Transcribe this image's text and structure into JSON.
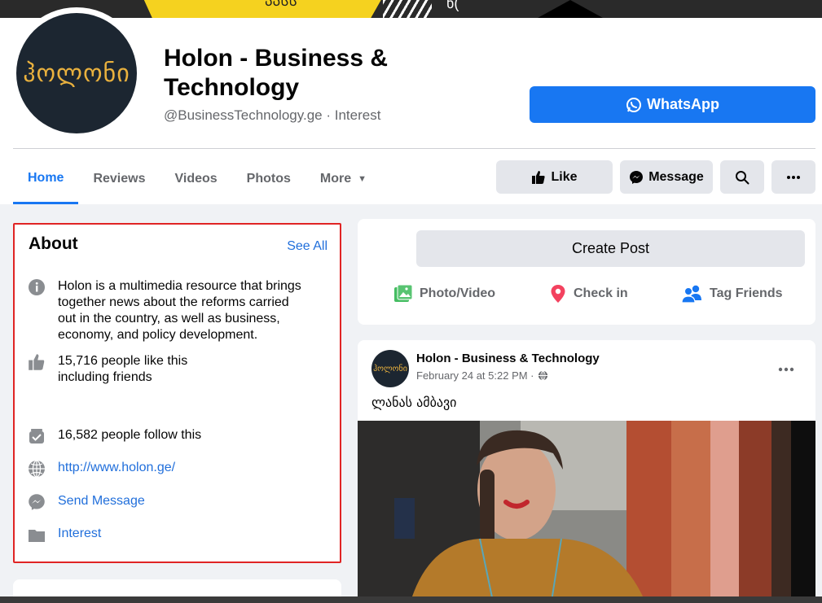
{
  "cover": {
    "sign_text": "ᲐᲐᲡᲡ",
    "sign_fragment": "ნ("
  },
  "page": {
    "logo_text": "ჰოლონი",
    "name": "Holon - Business & Technology",
    "handle": "@BusinessTechnology.ge · Interest",
    "whatsapp_label": "WhatsApp"
  },
  "tabs": [
    {
      "label": "Home",
      "active": true
    },
    {
      "label": "Reviews"
    },
    {
      "label": "Videos"
    },
    {
      "label": "Photos"
    },
    {
      "label": "More"
    }
  ],
  "actions": {
    "like": "Like",
    "message": "Message"
  },
  "about": {
    "title": "About",
    "see_all": "See All",
    "description": "Holon is a multimedia resource that brings together news about the reforms carried out in the country, as well as business, economy, and policy development.",
    "likes": "15,716 people like this including friends",
    "follows": "16,582 people follow this",
    "website": "http://www.holon.ge/",
    "send_message": "Send Message",
    "category": "Interest"
  },
  "create_post": {
    "label": "Create Post",
    "photo_video": "Photo/Video",
    "check_in": "Check in",
    "tag_friends": "Tag Friends"
  },
  "post": {
    "author": "Holon - Business & Technology",
    "date": "February 24 at 5:22 PM ·",
    "text": "ლანას ამბავი"
  },
  "colors": {
    "accent": "#1877f2",
    "highlight_border": "#e02424",
    "logo_bg": "#1c2631",
    "logo_text": "#e9b13e"
  }
}
